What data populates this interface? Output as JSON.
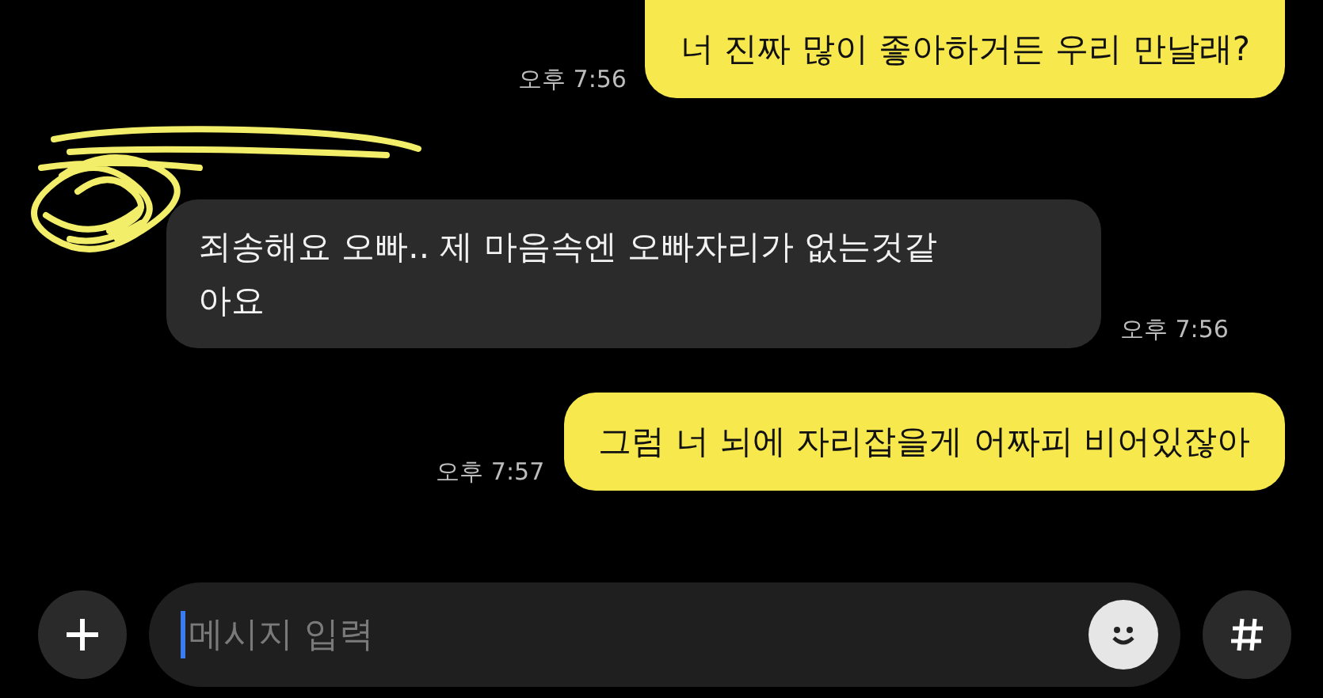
{
  "messages": [
    {
      "kind": "sent",
      "text": "너 진짜 많이 좋아하거든 우리 만날래?",
      "time": "오후 7:56"
    },
    {
      "kind": "received",
      "text": "죄송해요 오빠.. 제 마음속엔 오빠자리가 없는것같\n아요",
      "time": "오후 7:56"
    },
    {
      "kind": "sent",
      "text": "그럼 너 뇌에 자리잡을게 어짜피 비어있잖아",
      "time": "오후 7:57"
    }
  ],
  "composer": {
    "placeholder": "메시지 입력"
  }
}
